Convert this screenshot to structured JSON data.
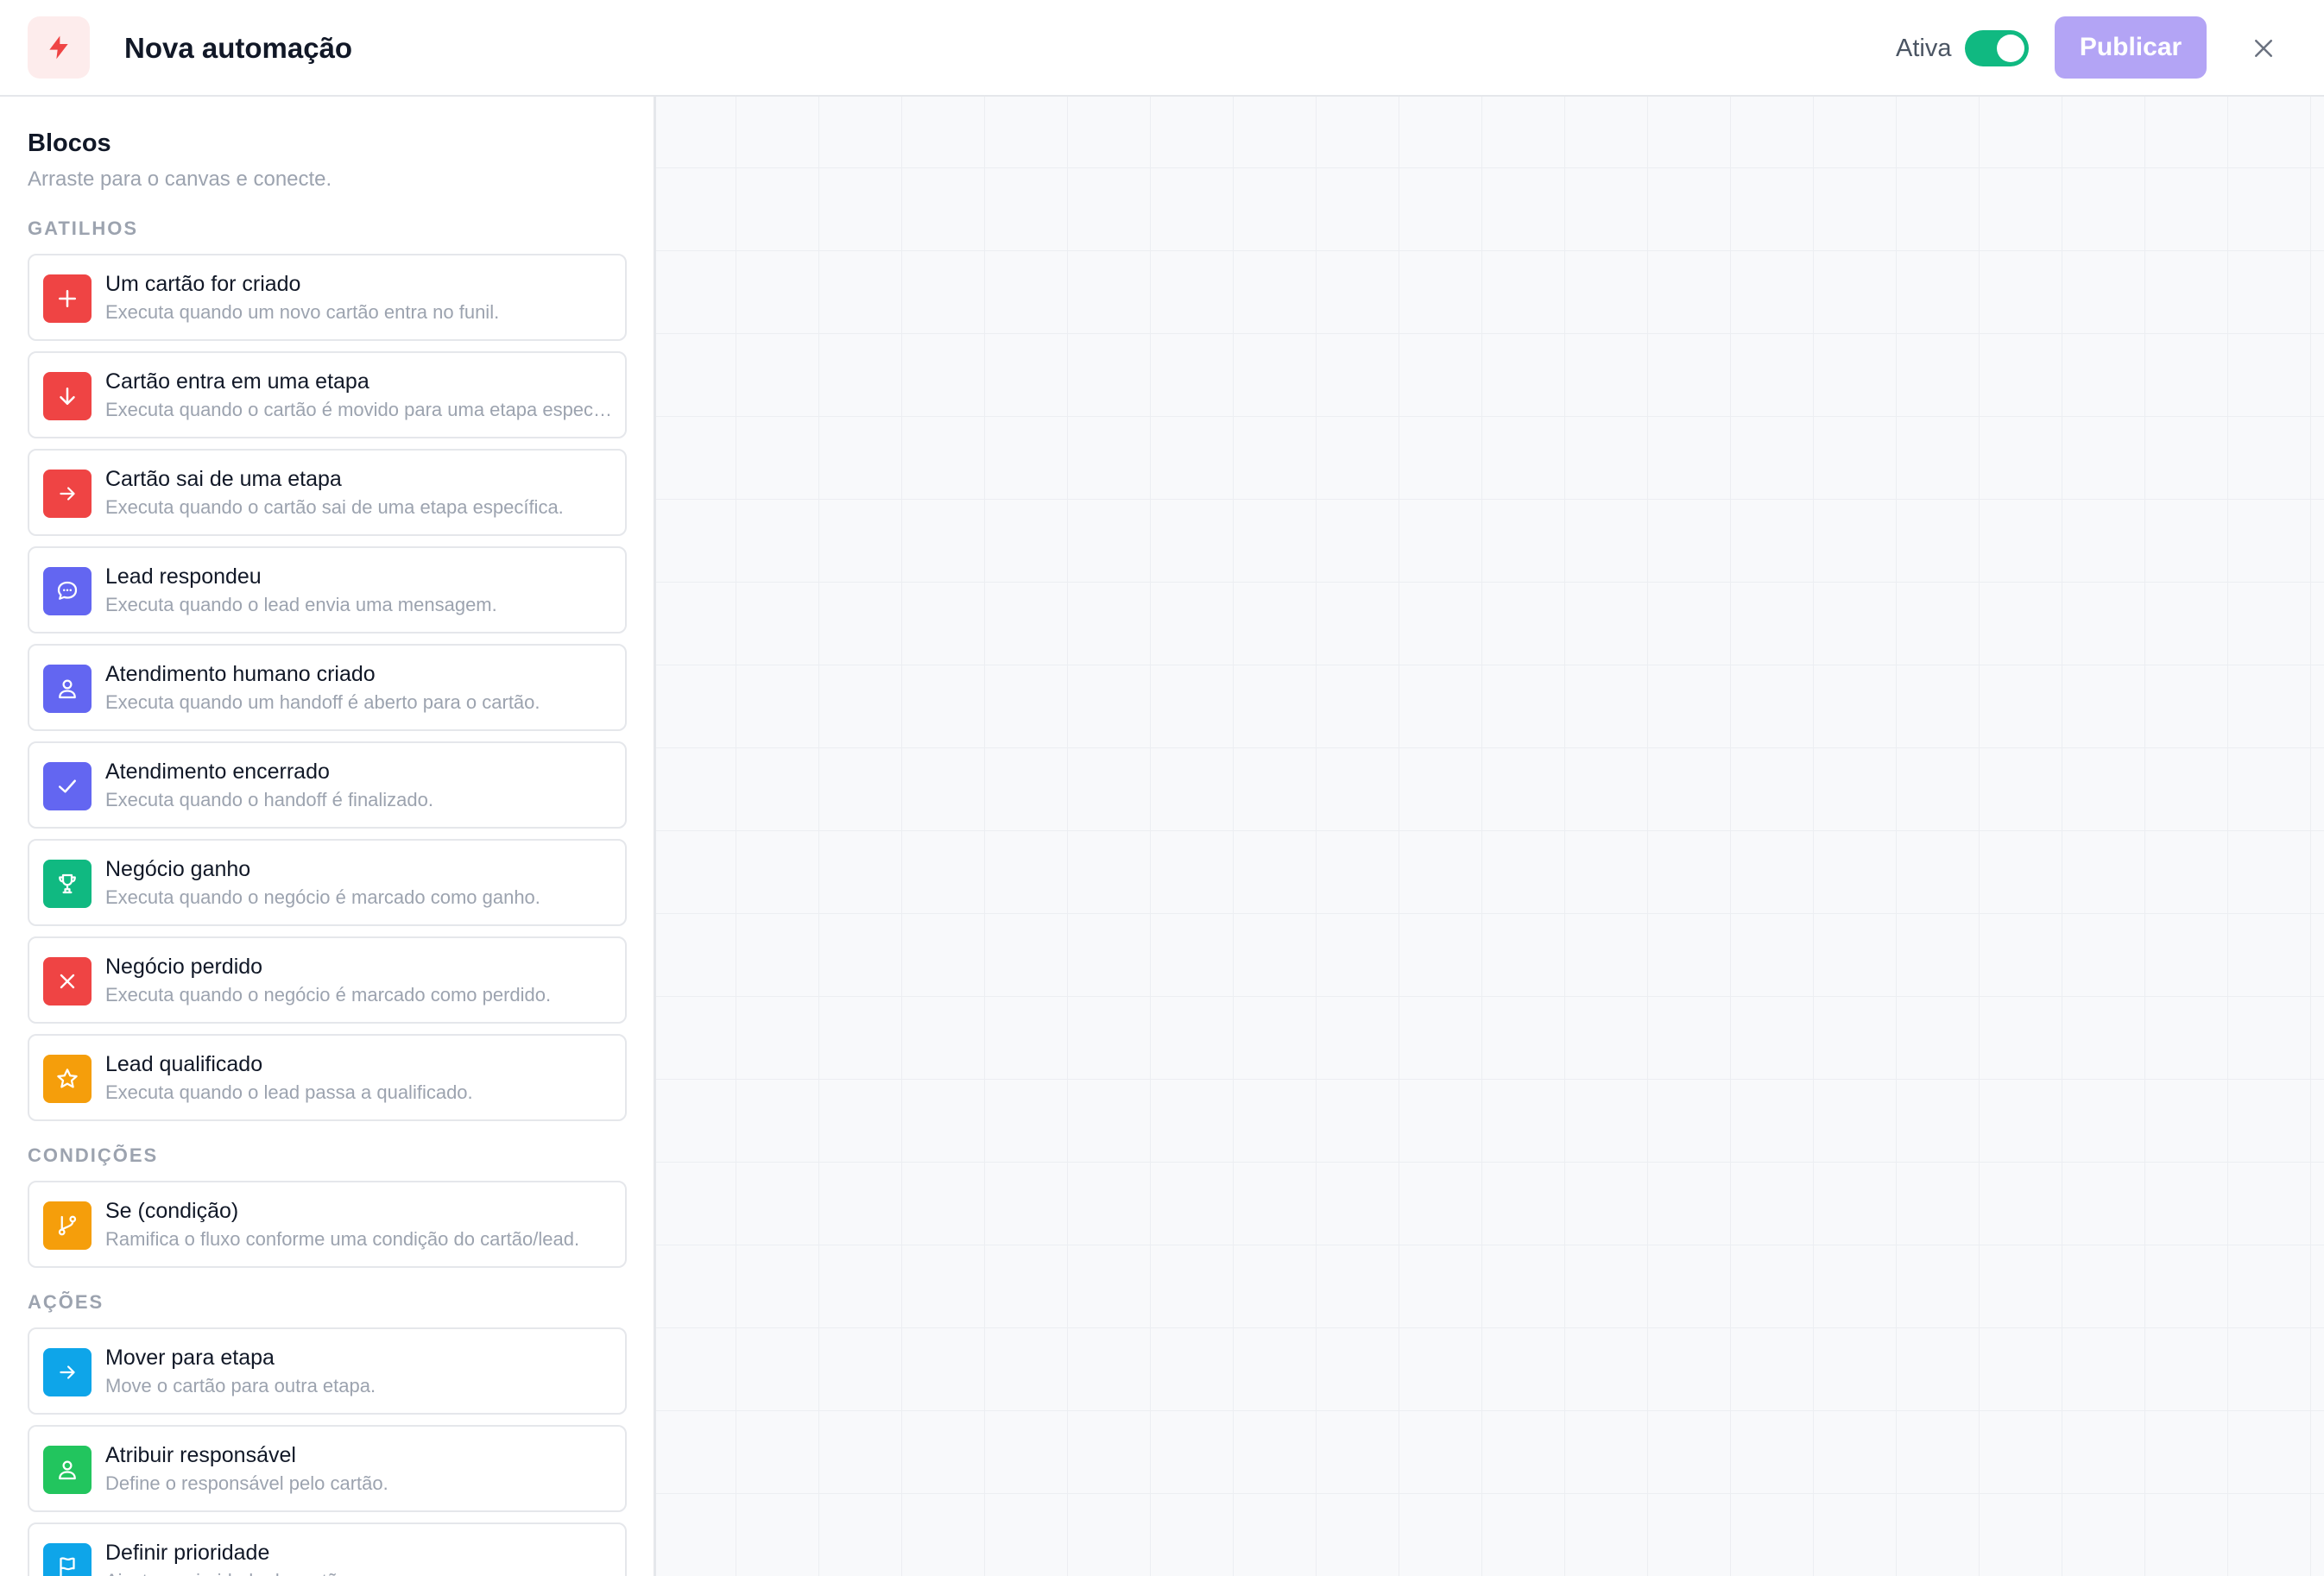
{
  "header": {
    "icon": "lightning-icon",
    "title": "Nova automação",
    "active_label": "Ativa",
    "active_on": true,
    "publish_label": "Publicar",
    "close_icon": "close-icon",
    "accent_color": "#b3a4f5"
  },
  "sidebar": {
    "title": "Blocos",
    "subtitle": "Arraste para o canvas e conecte.",
    "sections": [
      {
        "label": "GATILHOS",
        "items": [
          {
            "title": "Um cartão for criado",
            "description": "Executa quando um novo cartão entra no funil.",
            "icon": "plus-icon",
            "color": "#ef4444"
          },
          {
            "title": "Cartão entra em uma etapa",
            "description": "Executa quando o cartão é movido para uma etapa específica.",
            "icon": "arrow-down-icon",
            "color": "#ef4444"
          },
          {
            "title": "Cartão sai de uma etapa",
            "description": "Executa quando o cartão sai de uma etapa específica.",
            "icon": "arrow-right-icon",
            "color": "#ef4444"
          },
          {
            "title": "Lead respondeu",
            "description": "Executa quando o lead envia uma mensagem.",
            "icon": "message-icon",
            "color": "#6366f1"
          },
          {
            "title": "Atendimento humano criado",
            "description": "Executa quando um handoff é aberto para o cartão.",
            "icon": "user-icon",
            "color": "#6366f1"
          },
          {
            "title": "Atendimento encerrado",
            "description": "Executa quando o handoff é finalizado.",
            "icon": "check-icon",
            "color": "#6366f1"
          },
          {
            "title": "Negócio ganho",
            "description": "Executa quando o negócio é marcado como ganho.",
            "icon": "trophy-icon",
            "color": "#10b981"
          },
          {
            "title": "Negócio perdido",
            "description": "Executa quando o negócio é marcado como perdido.",
            "icon": "x-icon",
            "color": "#ef4444"
          },
          {
            "title": "Lead qualificado",
            "description": "Executa quando o lead passa a qualificado.",
            "icon": "star-icon",
            "color": "#f59e0b"
          }
        ]
      },
      {
        "label": "CONDIÇÕES",
        "items": [
          {
            "title": "Se (condição)",
            "description": "Ramifica o fluxo conforme uma condição do cartão/lead.",
            "icon": "branch-icon",
            "color": "#f59e0b"
          }
        ]
      },
      {
        "label": "AÇÕES",
        "items": [
          {
            "title": "Mover para etapa",
            "description": "Move o cartão para outra etapa.",
            "icon": "arrow-right-icon",
            "color": "#0ea5e9"
          },
          {
            "title": "Atribuir responsável",
            "description": "Define o responsável pelo cartão.",
            "icon": "user-icon",
            "color": "#22c55e"
          },
          {
            "title": "Definir prioridade",
            "description": "Ajusta a prioridade do cartão.",
            "icon": "flag-icon",
            "color": "#0ea5e9"
          }
        ]
      }
    ]
  }
}
